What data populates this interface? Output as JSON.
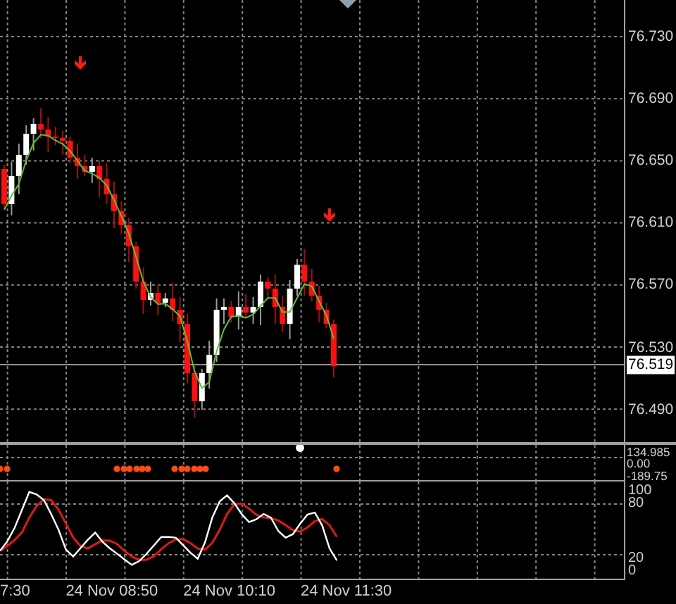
{
  "price_axis": {
    "ticks": [
      "76.730",
      "76.690",
      "76.650",
      "76.610",
      "76.570",
      "76.530",
      "76.490"
    ],
    "current_price": "76.519"
  },
  "indicator_axis": {
    "ticks": [
      "134.985",
      "0.00",
      "-189.75"
    ]
  },
  "oscillator_axis": {
    "ticks": [
      "100",
      "80",
      "20",
      "0"
    ]
  },
  "time_axis": {
    "ticks": [
      "7:30",
      "24 Nov 08:50",
      "24 Nov 10:10",
      "24 Nov 11:30"
    ]
  }
}
